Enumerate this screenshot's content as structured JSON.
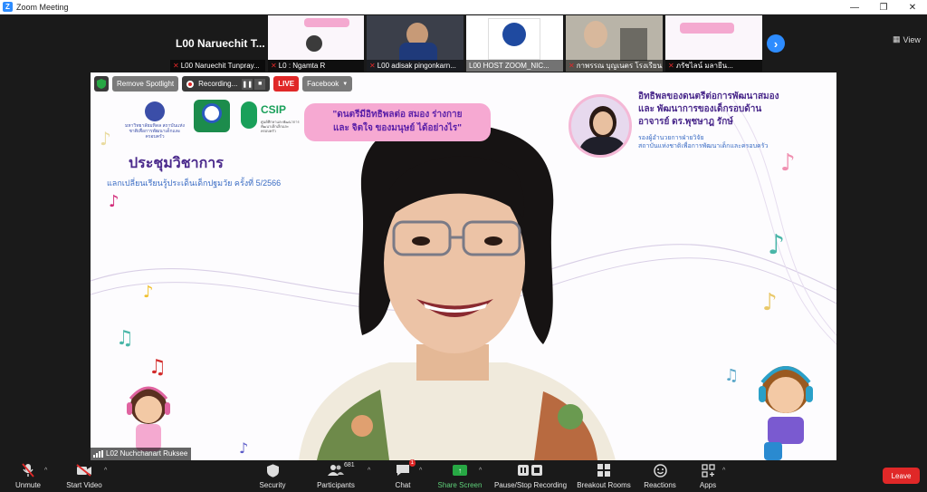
{
  "window": {
    "title": "Zoom Meeting",
    "controls": [
      "—",
      "❐",
      "✕"
    ]
  },
  "strip": {
    "active_speaker_label": "L00 Naruechit T...",
    "tiles": [
      {
        "name": "L00 Naruechit Tunpray..."
      },
      {
        "name": "L0 : Ngamta R"
      },
      {
        "name": "L00 adisak pingonkarn..."
      },
      {
        "name": "L00 HOST ZOOM_NIC..."
      },
      {
        "name": "กาพรรณ บุญเนตร โรงเรียน..."
      },
      {
        "name": "ภรัชไลน์ มลายีน..."
      }
    ],
    "view_label": "View"
  },
  "overlay": {
    "remove_spotlight": "Remove Spotlight",
    "recording": "Recording...",
    "live": "LIVE",
    "facebook": "Facebook"
  },
  "slide": {
    "pill_title_line1": "\"ดนตรีมีอิทธิพลต่อ สมอง ร่างกาย",
    "pill_title_line2": "และ จิตใจ ของมนุษย์ ได้อย่างไร\"",
    "heading": "ประชุมวิชาการ",
    "subheading": "แลกเปลี่ยนเรียนรู้ประเด็นเด็กปฐมวัย ครั้งที่ 5/2566",
    "right_title_line1": "อิทธิพลของดนตรีต่อการพัฒนาสมอง",
    "right_title_line2": "และ พัฒนาการของเด็กรอบด้าน",
    "right_title_line3": "อาจารย์ ดร.พุชษาฎ รักษ์",
    "right_sub_line1": "รองผู้อำนวยการฝ่ายวิจัย",
    "right_sub_line2": "สถาบันแห่งชาติเพื่อการพัฒนาเด็กและครอบครัว",
    "csip": "CSIP",
    "csip_sub": "ศูนย์ศึกษาและพัฒนาการพัฒนาเด็กเล็กและครอบครัว",
    "uni_text": "มหาวิทยาลัยมหิดล สถาบันแห่งชาติเพื่อการพัฒนาเด็กและครอบครัว"
  },
  "speaker_name": "L02 Nuchchanart Ruksee",
  "toolbar": {
    "unmute": "Unmute",
    "start_video": "Start Video",
    "security": "Security",
    "participants": "Participants",
    "participants_count": "681",
    "chat": "Chat",
    "chat_badge": "1",
    "share_screen": "Share Screen",
    "pause_recording": "Pause/Stop Recording",
    "breakout_rooms": "Breakout Rooms",
    "reactions": "Reactions",
    "apps": "Apps",
    "leave": "Leave"
  }
}
